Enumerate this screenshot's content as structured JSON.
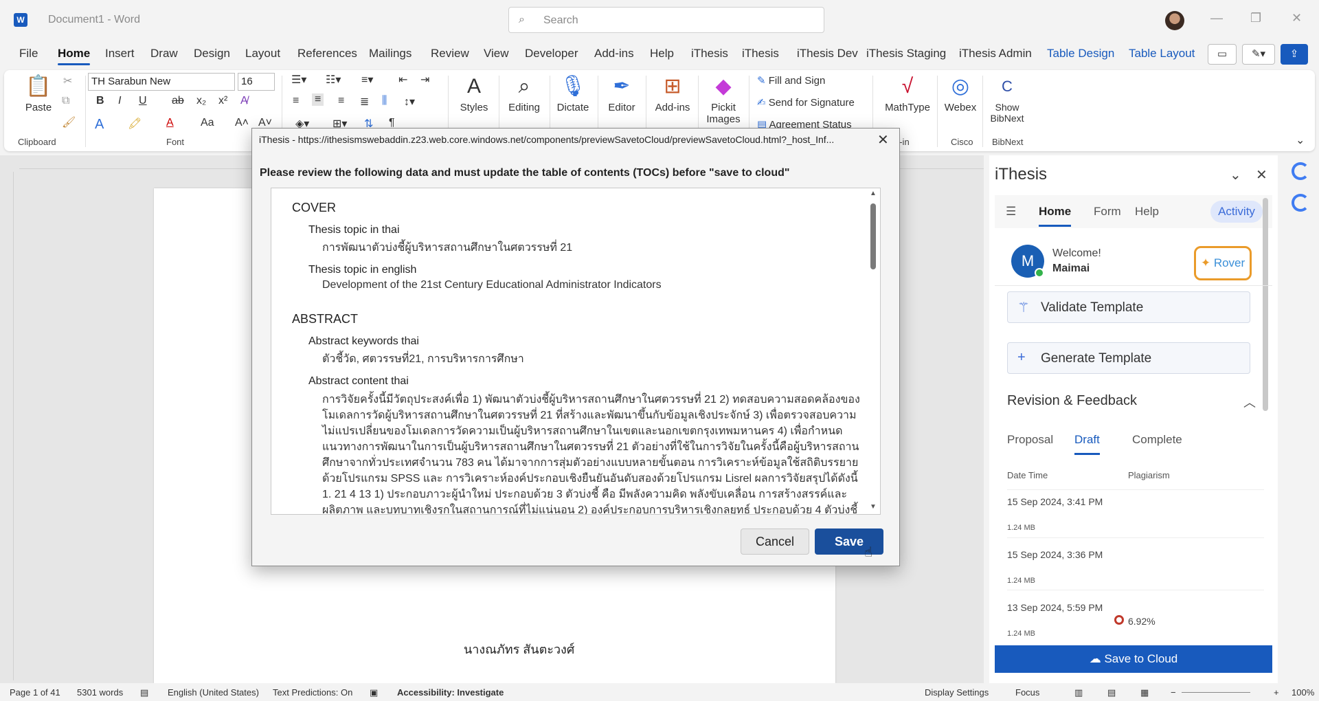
{
  "window": {
    "app_icon": "W",
    "doc_title": "Document1  -  Word",
    "search_placeholder": "Search"
  },
  "menu_tabs": [
    "File",
    "Home",
    "Insert",
    "Draw",
    "Design",
    "Layout",
    "References",
    "Mailings",
    "Review",
    "View",
    "Developer",
    "Add-ins",
    "Help",
    "iThesis",
    "iThesis",
    "iThesis Dev",
    "iThesis Staging",
    "iThesis Admin",
    "Table Design",
    "Table Layout"
  ],
  "ribbon": {
    "clipboard": {
      "paste": "Paste",
      "label": "Clipboard"
    },
    "font": {
      "name": "TH Sarabun New",
      "size": "16",
      "label": "Font"
    },
    "styles": "Styles",
    "editing": "Editing",
    "dictate": "Dictate",
    "editor": "Editor",
    "addins": "Add-ins",
    "pickit": [
      "Pickit",
      "Images"
    ],
    "fill_sign": "Fill and Sign",
    "send_sig": "Send for Signature",
    "agreement": "Agreement Status",
    "mathtype": "MathType",
    "webex": "Webex",
    "bibnext": [
      "Show",
      "BibNext"
    ],
    "group_addin": "d-in",
    "group_cisco": "Cisco",
    "group_bibnext": "BibNext"
  },
  "document": {
    "page_text": "นางณภัทร สันตะวงศ์"
  },
  "statusbar": {
    "page": "Page 1 of 41",
    "words": "5301 words",
    "language": "English (United States)",
    "predictions": "Text Predictions: On",
    "accessibility": "Accessibility: Investigate",
    "display": "Display Settings",
    "focus": "Focus",
    "zoom": "100%"
  },
  "pane": {
    "title": "iThesis",
    "nav": [
      "Home",
      "Form",
      "Help"
    ],
    "activity": "Activity",
    "avatar_letter": "M",
    "welcome": "Welcome!",
    "user": "Maimai",
    "rover": "Rover",
    "validate": "Validate Template",
    "generate": "Generate Template",
    "revision": "Revision & Feedback",
    "rtabs": [
      "Proposal",
      "Draft",
      "Complete"
    ],
    "col_date": "Date Time",
    "col_plag": "Plagiarism",
    "rows": [
      {
        "date": "15 Sep 2024, 3:41 PM",
        "size": "1.24 MB"
      },
      {
        "date": "15 Sep 2024, 3:36 PM",
        "size": "1.24 MB"
      },
      {
        "date": "13 Sep 2024, 5:59 PM",
        "size": "1.24 MB",
        "plagiarism": "6.92%"
      }
    ],
    "save_cloud": "Save to Cloud"
  },
  "dialog": {
    "title": "iThesis - https://ithesismswebaddin.z23.web.core.windows.net/components/previewSavetoCloud/previewSavetoCloud.html?_host_Inf...",
    "message": "Please review the following data and must update the table of contents (TOCs) before \"save to cloud\"",
    "cover": "COVER",
    "topic_thai_label": "Thesis topic in thai",
    "topic_thai": "การพัฒนาตัวบ่งชี้ผู้บริหารสถานศึกษาในศตวรรษที่ 21",
    "topic_en_label": "Thesis topic in english",
    "topic_en": "Development of the 21st Century Educational Administrator Indicators",
    "abstract": "ABSTRACT",
    "kw_label": "Abstract keywords thai",
    "kw": "ตัวชี้วัด, ศตวรรษที่21, การบริหารการศึกษา",
    "content_label": "Abstract content thai",
    "content": "การวิจัยครั้งนี้มีวัตถุประสงค์เพื่อ 1) พัฒนาตัวบ่งชี้ผู้บริหารสถานศึกษาในศตวรรษที่ 21 2) ทดสอบความสอดคล้องของโมเดลการวัดผู้บริหารสถานศึกษาในศตวรรษที่ 21 ที่สร้างและพัฒนาขึ้นกับข้อมูลเชิงประจักษ์ 3) เพื่อตรวจสอบความไม่แปรเปลี่ยนของโมเดลการวัดความเป็นผู้บริหารสถานศึกษาในเขตและนอกเขตกรุงเทพมหานคร 4) เพื่อกำหนดแนวทางการพัฒนาในการเป็นผู้บริหารสถานศึกษาในศตวรรษที่ 21 ตัวอย่างที่ใช้ในการวิจัยในครั้งนี้คือผู้บริหารสถานศึกษาจากทั่วประเทศจำนวน 783 คน ได้มาจากการสุ่มตัวอย่างแบบหลายขั้นตอน การวิเคราะห์ข้อมูลใช้สถิติบรรยาย ด้วยโปรแกรม SPSS และ การวิเคราะห์องค์ประกอบเชิงยืนยันอันดับสองด้วยโปรแกรม Lisrel ผลการวิจัยสรุปได้ดังนี้ 1. 21 4 13 1) ประกอบภาวะผู้นำใหม่ ประกอบด้วย 3 ตัวบ่งชี้ คือ มีพลังความคิด พลังขับเคลื่อน การสร้างสรรค์และผลิตภาพ และบทบาทเชิงรุกในสถานการณ์ที่ไม่แน่นอน 2) องค์ประกอบการบริหารเชิงกลยุทธ์ ประกอบด้วย 4 ตัวบ่งชี้ คือ ผลการปฏิบัติงานที่โดดเด่น การสร้างทางเลือกเชิงกลยุทธ์ การจัดสินใจ",
    "cancel": "Cancel",
    "save": "Save"
  }
}
